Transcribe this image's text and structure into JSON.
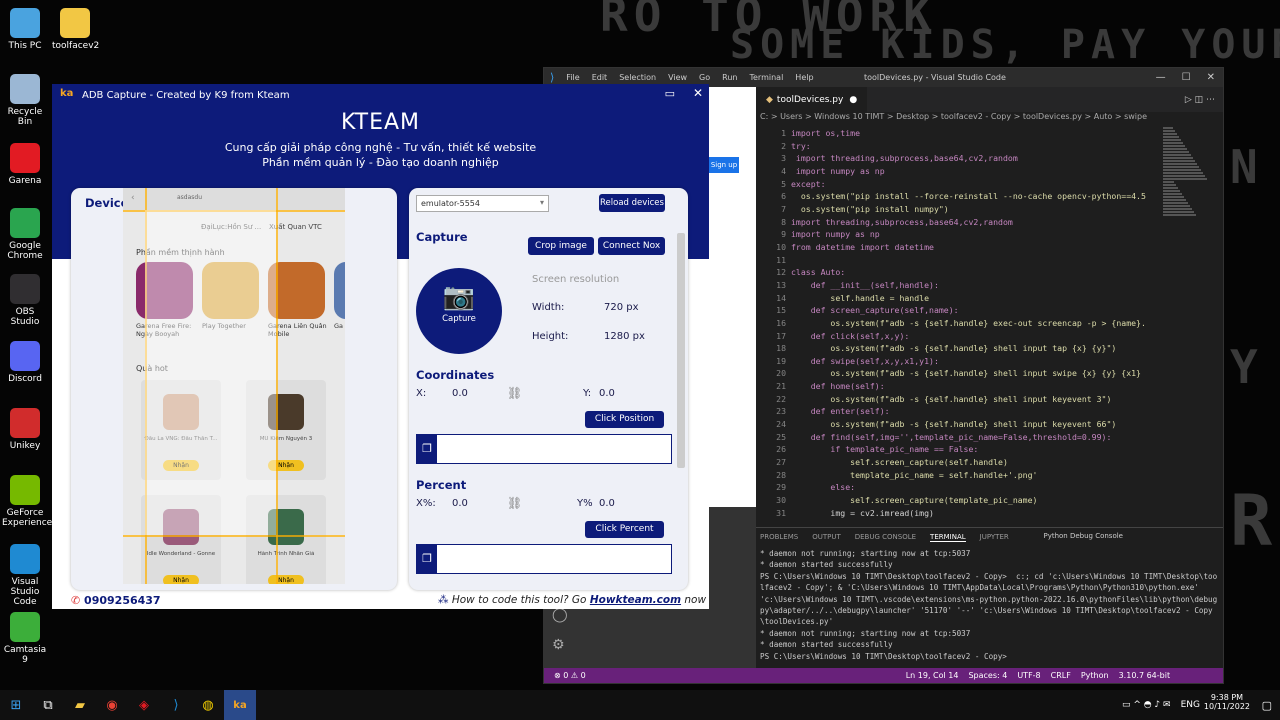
{
  "desktop": {
    "bg_text": [
      "RO TO WORK",
      "SOME KIDS, PAY YOUR",
      "N",
      "Y",
      "R"
    ],
    "icons": [
      {
        "label": "This PC",
        "icon": "computer-icon",
        "color": "#4aa3df"
      },
      {
        "label": "toolfacev2",
        "icon": "folder-icon",
        "color": "#f2c744"
      },
      {
        "label": "Recycle Bin",
        "icon": "recycle-bin-icon",
        "color": "#9bb7d4"
      },
      {
        "label": "Garena",
        "icon": "garena-icon",
        "color": "#e21b23"
      },
      {
        "label": "Google Chrome",
        "icon": "chrome-icon",
        "color": "#2aa54f"
      },
      {
        "label": "OBS Studio",
        "icon": "obs-icon",
        "color": "#302e31"
      },
      {
        "label": "Discord",
        "icon": "discord-icon",
        "color": "#5865f2"
      },
      {
        "label": "Unikey",
        "icon": "unikey-icon",
        "color": "#d12c2c"
      },
      {
        "label": "GeForce Experience",
        "icon": "nvidia-icon",
        "color": "#76b900"
      },
      {
        "label": "Visual Studio Code",
        "icon": "vscode-icon",
        "color": "#1f8ad2"
      },
      {
        "label": "Camtasia 9",
        "icon": "camtasia-icon",
        "color": "#3cae3a"
      }
    ]
  },
  "vscode": {
    "menu": [
      "File",
      "Edit",
      "Selection",
      "View",
      "Go",
      "Run",
      "Terminal",
      "Help"
    ],
    "title": "toolDevices.py - Visual Studio Code",
    "tab": "toolDevices.py",
    "breadcrumb": "C: > Users > Windows 10 TIMT > Desktop > toolfacev2 - Copy > toolDevices.py > Auto > swipe",
    "sign_up": "Sign up",
    "code": [
      {
        "n": "1",
        "t": "import os,time"
      },
      {
        "n": "2",
        "t": "try:"
      },
      {
        "n": "3",
        "t": " import threading,subprocess,base64,cv2,random"
      },
      {
        "n": "4",
        "t": " import numpy as np"
      },
      {
        "n": "5",
        "t": "except:"
      },
      {
        "n": "6",
        "t": "  os.system(\"pip install --force-reinstall --no-cache opencv-python==4.5"
      },
      {
        "n": "7",
        "t": "  os.system(\"pip install numpy\")"
      },
      {
        "n": "8",
        "t": "import threading,subprocess,base64,cv2,random"
      },
      {
        "n": "9",
        "t": "import numpy as np"
      },
      {
        "n": "10",
        "t": "from datetime import datetime"
      },
      {
        "n": "11",
        "t": ""
      },
      {
        "n": "12",
        "t": "class Auto:"
      },
      {
        "n": "13",
        "t": "    def __init__(self,handle):"
      },
      {
        "n": "14",
        "t": "        self.handle = handle"
      },
      {
        "n": "15",
        "t": "    def screen_capture(self,name):"
      },
      {
        "n": "16",
        "t": "        os.system(f\"adb -s {self.handle} exec-out screencap -p > {name}."
      },
      {
        "n": "17",
        "t": "    def click(self,x,y):"
      },
      {
        "n": "18",
        "t": "        os.system(f\"adb -s {self.handle} shell input tap {x} {y}\")"
      },
      {
        "n": "19",
        "t": "    def swipe(self,x,y,x1,y1):"
      },
      {
        "n": "20",
        "t": "        os.system(f\"adb -s {self.handle} shell input swipe {x} {y} {x1}"
      },
      {
        "n": "21",
        "t": "    def home(self):"
      },
      {
        "n": "22",
        "t": "        os.system(f\"adb -s {self.handle} shell input keyevent 3\")"
      },
      {
        "n": "23",
        "t": "    def enter(self):"
      },
      {
        "n": "24",
        "t": "        os.system(f\"adb -s {self.handle} shell input keyevent 66\")"
      },
      {
        "n": "25",
        "t": "    def find(self,img='',template_pic_name=False,threshold=0.99):"
      },
      {
        "n": "26",
        "t": "        if template_pic_name == False:"
      },
      {
        "n": "27",
        "t": "            self.screen_capture(self.handle)"
      },
      {
        "n": "28",
        "t": "            template_pic_name = self.handle+'.png'"
      },
      {
        "n": "29",
        "t": "        else:"
      },
      {
        "n": "30",
        "t": "            self.screen_capture(template_pic_name)"
      },
      {
        "n": "31",
        "t": "        img = cv2.imread(img)"
      }
    ],
    "panel_tabs": [
      "PROBLEMS",
      "OUTPUT",
      "DEBUG CONSOLE",
      "TERMINAL",
      "JUPYTER"
    ],
    "debug_console": "Python Debug Console",
    "terminal": [
      "* daemon not running; starting now at tcp:5037",
      "* daemon started successfully",
      "PS C:\\Users\\Windows 10 TIMT\\Desktop\\toolfacev2 - Copy>  c:; cd 'c:\\Users\\Windows 10 TIMT\\Desktop\\toolfacev2 - Copy'; & 'C:\\Users\\Windows 10 TIMT\\AppData\\Local\\Programs\\Python\\Python310\\python.exe' 'c:\\Users\\Windows 10 TIMT\\.vscode\\extensions\\ms-python.python-2022.16.0\\pythonFiles\\lib\\python\\debugpy\\adapter/../..\\debugpy\\launcher' '51170' '--' 'c:\\Users\\Windows 10 TIMT\\Desktop\\toolfacev2 - Copy\\toolDevices.py'",
      "* daemon not running; starting now at tcp:5037",
      "* daemon started successfully",
      "PS C:\\Users\\Windows 10 TIMT\\Desktop\\toolfacev2 - Copy>"
    ],
    "status": {
      "errors": "⊗ 0 ⚠ 0",
      "pos": "Ln 19, Col 14",
      "spaces": "Spaces: 4",
      "enc": "UTF-8",
      "eol": "CRLF",
      "lang": "Python",
      "ver": "3.10.7 64-bit"
    }
  },
  "adb": {
    "title": "ADB Capture - Created by K9 from Kteam",
    "logo": "KTEAM",
    "tagline1": "Cung cấp giải pháp công nghệ - Tư vấn, thiết kế website",
    "tagline2": "Phần mềm quản lý - Đào tạo doanh nghiệp",
    "device_header": "Device",
    "phone": {
      "search": "asdasdu",
      "chips": [
        "ĐạiLục:Hồn Sư ...",
        "Xuất Quan VTC"
      ],
      "section1": "Phần mềm thịnh hành",
      "apps": [
        {
          "name": "Garena Free Fire: Ngày Booyah",
          "color": "#8a2a6a"
        },
        {
          "name": "Play Together",
          "color": "#d9a43a"
        },
        {
          "name": "Garena Liên Quân Mobile",
          "color": "#c26a2a"
        },
        {
          "name": "Ga MA",
          "color": "#5a7ab0"
        }
      ],
      "section2": "Quà hot",
      "gifts": [
        {
          "name": "Đấu La VNG: Đấu Thần T...",
          "btn": "Nhận",
          "color": "#c89a7a"
        },
        {
          "name": "MU Kiếm Nguyên 3",
          "btn": "Nhận",
          "color": "#4a3a2a"
        },
        {
          "name": "Idle Wonderland - Gonne",
          "btn": "Nhận",
          "color": "#9a5a7a"
        },
        {
          "name": "Hành Trình Nhẫn Giả",
          "btn": "Nhận",
          "color": "#3a6a4a"
        }
      ]
    },
    "phone_number": "0909256437",
    "emulator": "emulator-5554",
    "reload": "Reload devices",
    "capture_header": "Capture",
    "crop": "Crop image",
    "connect": "Connect Nox",
    "capture_btn": "Capture",
    "resolution": "Screen resolution",
    "width_label": "Width:",
    "width_val": "720 px",
    "height_label": "Height:",
    "height_val": "1280 px",
    "coords_header": "Coordinates",
    "x_label": "X:",
    "x_val": "0.0",
    "y_label": "Y:",
    "y_val": "0.0",
    "click_pos": "Click Position",
    "percent_header": "Percent",
    "xp_label": "X%:",
    "xp_val": "0.0",
    "yp_label": "Y%",
    "yp_val": "0.0",
    "click_pct": "Click Percent",
    "footer_text": "How to code this tool? Go ",
    "footer_link": "Howkteam.com",
    "footer_end": " now"
  },
  "taskbar": {
    "time": "9:38 PM",
    "date": "10/11/2022",
    "lang": "ENG"
  }
}
